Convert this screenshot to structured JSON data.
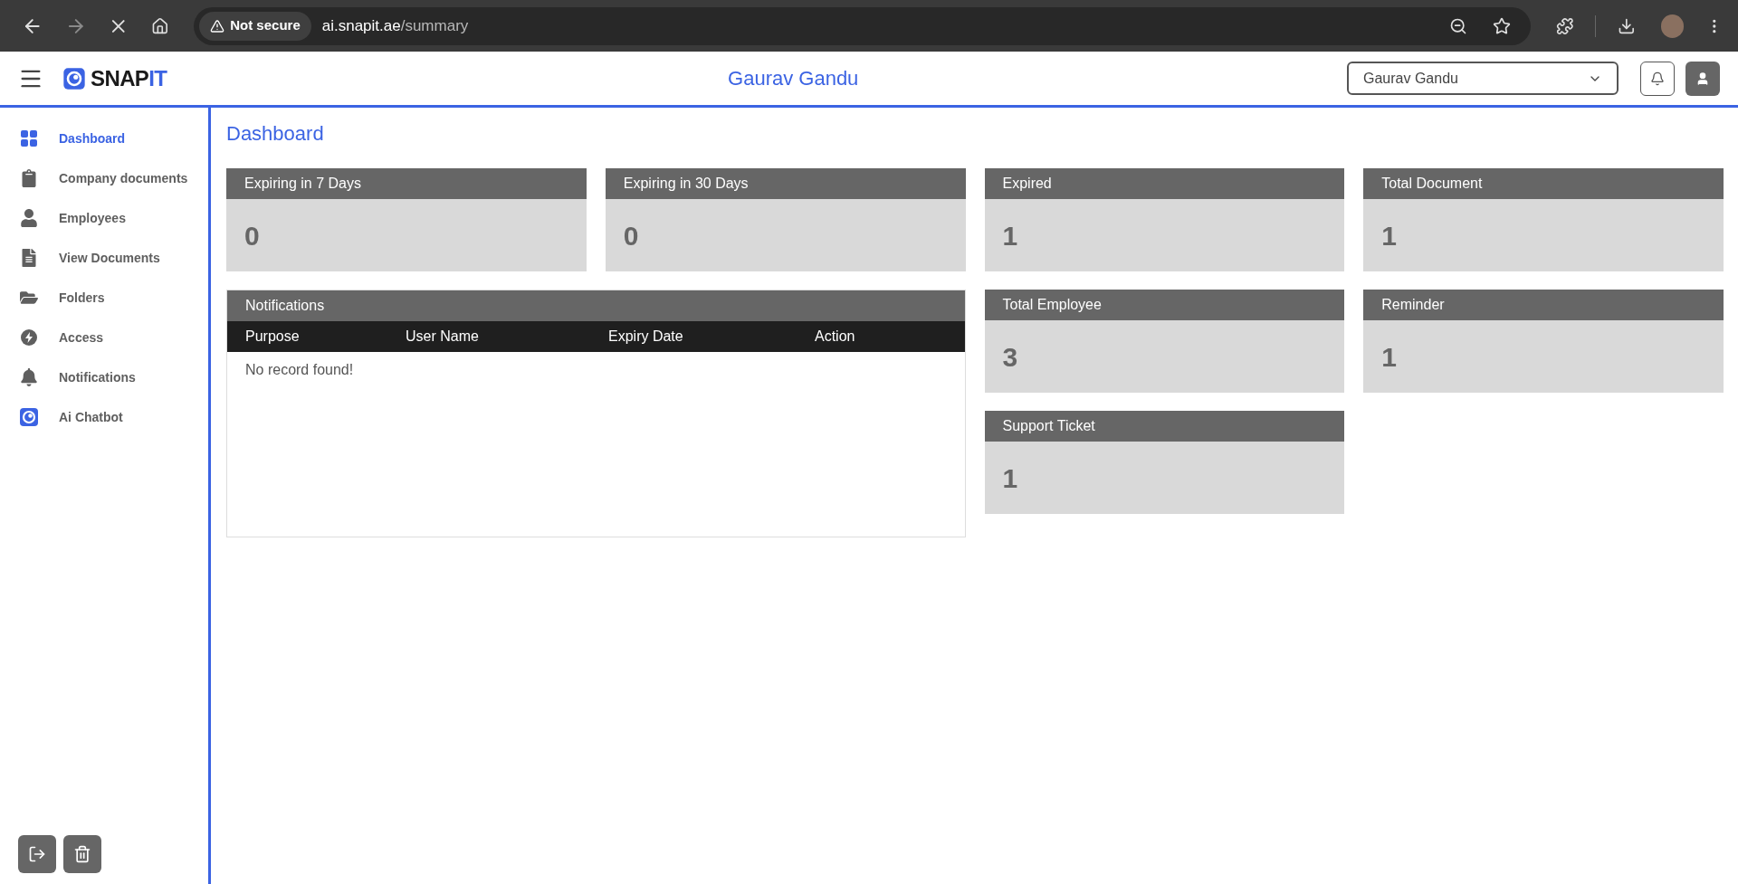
{
  "browser": {
    "security": "Not secure",
    "url_domain": "ai.snapit.ae",
    "url_path": "/summary"
  },
  "header": {
    "logo": {
      "main": "SNAP",
      "accent": "IT"
    },
    "title": "Gaurav Gandu",
    "user_select": {
      "value": "Gaurav Gandu"
    }
  },
  "sidebar": {
    "items": [
      {
        "label": "Dashboard",
        "kind": "grid",
        "selected": true
      },
      {
        "label": "Company documents",
        "kind": "clipboard",
        "selected": false
      },
      {
        "label": "Employees",
        "kind": "user",
        "selected": false
      },
      {
        "label": "View Documents",
        "kind": "file",
        "selected": false
      },
      {
        "label": "Folders",
        "kind": "folder",
        "selected": false
      },
      {
        "label": "Access",
        "kind": "bolt",
        "selected": false
      },
      {
        "label": "Notifications",
        "kind": "bell",
        "selected": false
      },
      {
        "label": "Ai Chatbot",
        "kind": "chatbot",
        "selected": false
      }
    ]
  },
  "page": {
    "title": "Dashboard",
    "panels": [
      {
        "kind": "stat",
        "title": "Expiring in 7 Days",
        "value": "0"
      },
      {
        "kind": "stat",
        "title": "Expiring in 30 Days",
        "value": "0"
      },
      {
        "kind": "stat",
        "title": "Expired",
        "value": "1"
      },
      {
        "kind": "stat",
        "title": "Total Document",
        "value": "1"
      },
      {
        "kind": "table",
        "title": "Notifications",
        "columns": [
          "Purpose",
          "User Name",
          "Expiry Date",
          "Action"
        ],
        "empty": "No record found!"
      },
      {
        "kind": "stat",
        "title": "Total Employee",
        "value": "3"
      },
      {
        "kind": "stat",
        "title": "Reminder",
        "value": "1"
      },
      {
        "kind": "stat",
        "title": "Support Ticket",
        "value": "1"
      }
    ]
  }
}
